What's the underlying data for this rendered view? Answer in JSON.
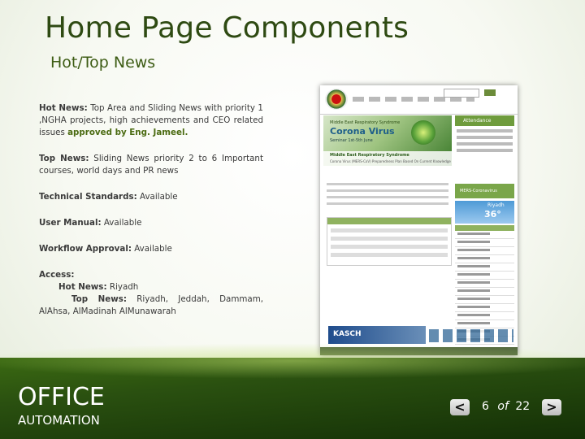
{
  "slide": {
    "title": "Home Page Components",
    "subtitle": "Hot/Top News",
    "items": {
      "hot_news_label": "Hot News:",
      "hot_news_text": " Top Area and Sliding News with priority 1 ,NGHA projects, high achievements and CEO related issues ",
      "hot_news_highlight": "approved by Eng. Jameel.",
      "top_news_label": "Top News:",
      "top_news_text": " Sliding News priority 2 to 6 Important courses, world days and PR news",
      "technical_label": "Technical Standards:",
      "technical_value": " Available",
      "manual_label": "User Manual:",
      "manual_value": "  Available",
      "workflow_label": "Workflow Approval:",
      "workflow_value": " Available",
      "access_label": "Access:",
      "access_hot_label": "Hot News:",
      "access_hot_value": " Riyadh",
      "access_top_label": "Top News:",
      "access_top_value": " Riyadh, Jeddah, Dammam, AlAhsa, AlMadinah AlMunawarah"
    }
  },
  "screenshot": {
    "banner_small": "Middle East Respiratory Syndrome",
    "banner_title": "Corona Virus",
    "banner_dates": "Seminar 1st-5th June",
    "banner_strip_title": "Middle East Respiratory Syndrome",
    "banner_strip_sub": "Corona Virus (MERS-CoV) Preparedness Plan Based On Current Knowledge",
    "attendance": "Attendance",
    "mers": "MERS-Coronavirus",
    "city": "Riyadh",
    "temp": "36°",
    "kasch": "KASCH"
  },
  "footer": {
    "brand_top": "OFFICE",
    "brand_bottom": "AUTOMATION",
    "prev": "<",
    "next": ">",
    "page_current": "6",
    "page_of": "of",
    "page_total": "22"
  },
  "colors": {
    "title": "#2e4a12",
    "accent_green": "#4b6b12",
    "band": "#2a5010"
  }
}
